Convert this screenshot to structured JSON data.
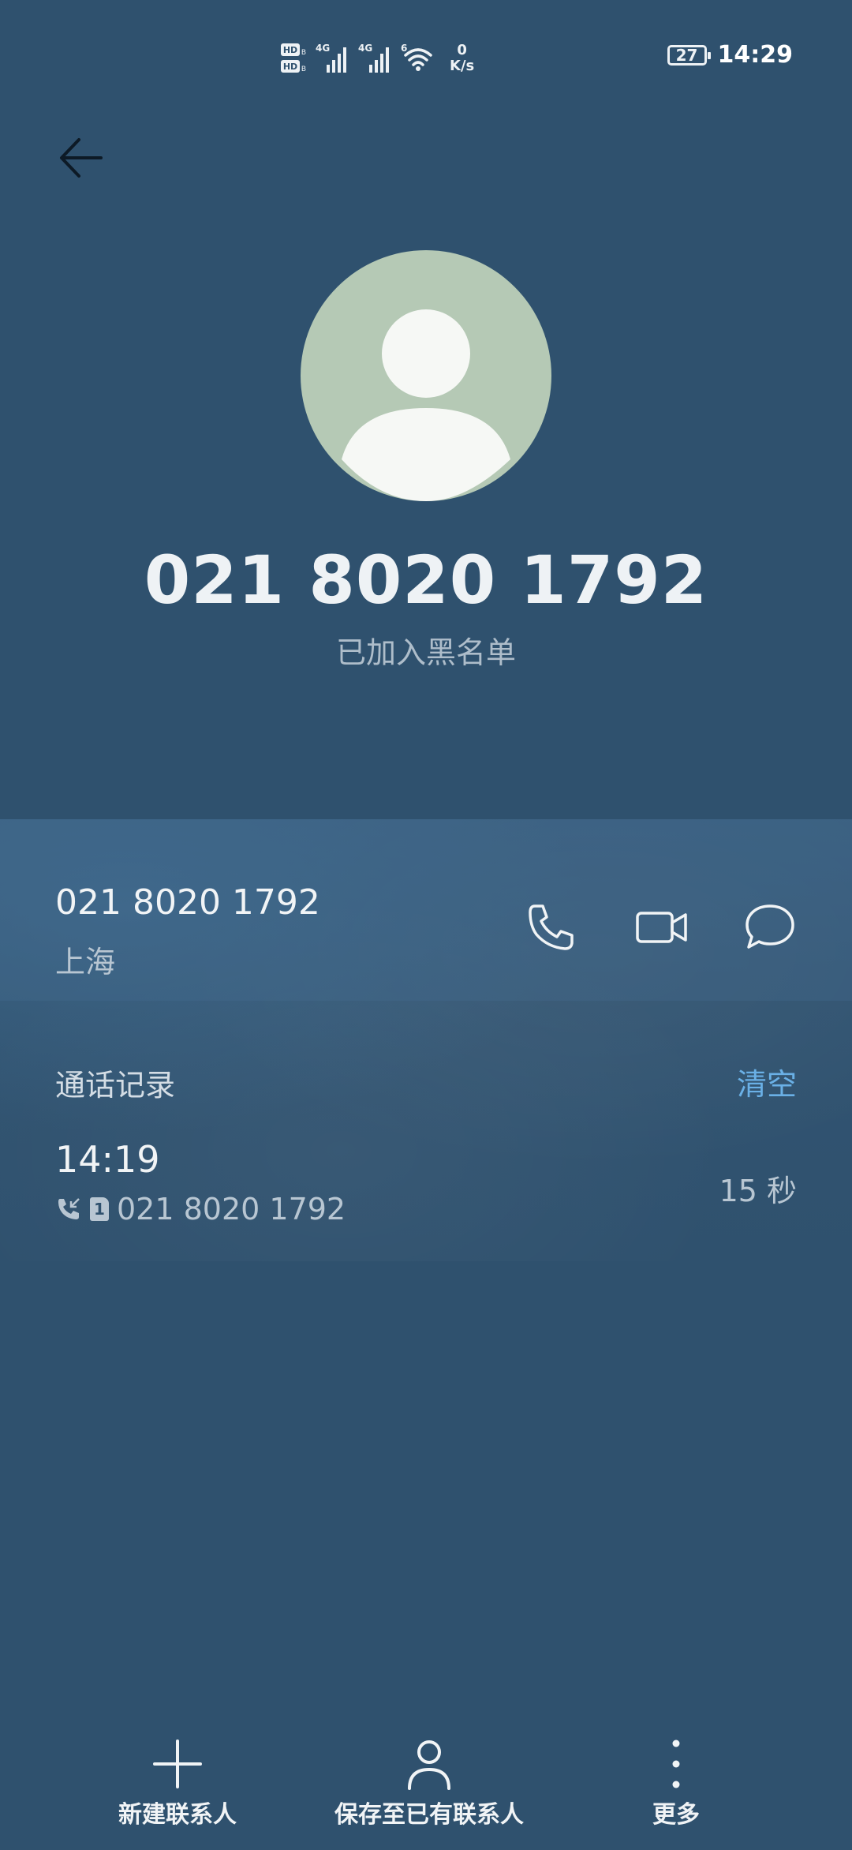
{
  "status_bar": {
    "net_speed_value": "0",
    "net_speed_unit": "K/s",
    "battery_level": "27",
    "time": "14:29",
    "signal_1_label": "4G",
    "signal_2_label": "4G",
    "wifi_label": "6"
  },
  "header": {
    "phone_number": "021 8020 1792",
    "status": "已加入黑名单"
  },
  "info_card": {
    "number": "021 8020 1792",
    "location": "上海",
    "actions": [
      "phone-icon",
      "video-call-icon",
      "message-icon"
    ]
  },
  "call_log": {
    "title": "通话记录",
    "clear_label": "清空",
    "entries": [
      {
        "time": "14:19",
        "sim": "1",
        "number": "021 8020 1792",
        "duration": "15 秒"
      }
    ]
  },
  "bottom_nav": {
    "new_contact": "新建联系人",
    "save_existing": "保存至已有联系人",
    "more": "更多"
  },
  "colors": {
    "background": "#2f516e",
    "accent": "#6ab0e6",
    "avatar": "#b5c9b5"
  }
}
